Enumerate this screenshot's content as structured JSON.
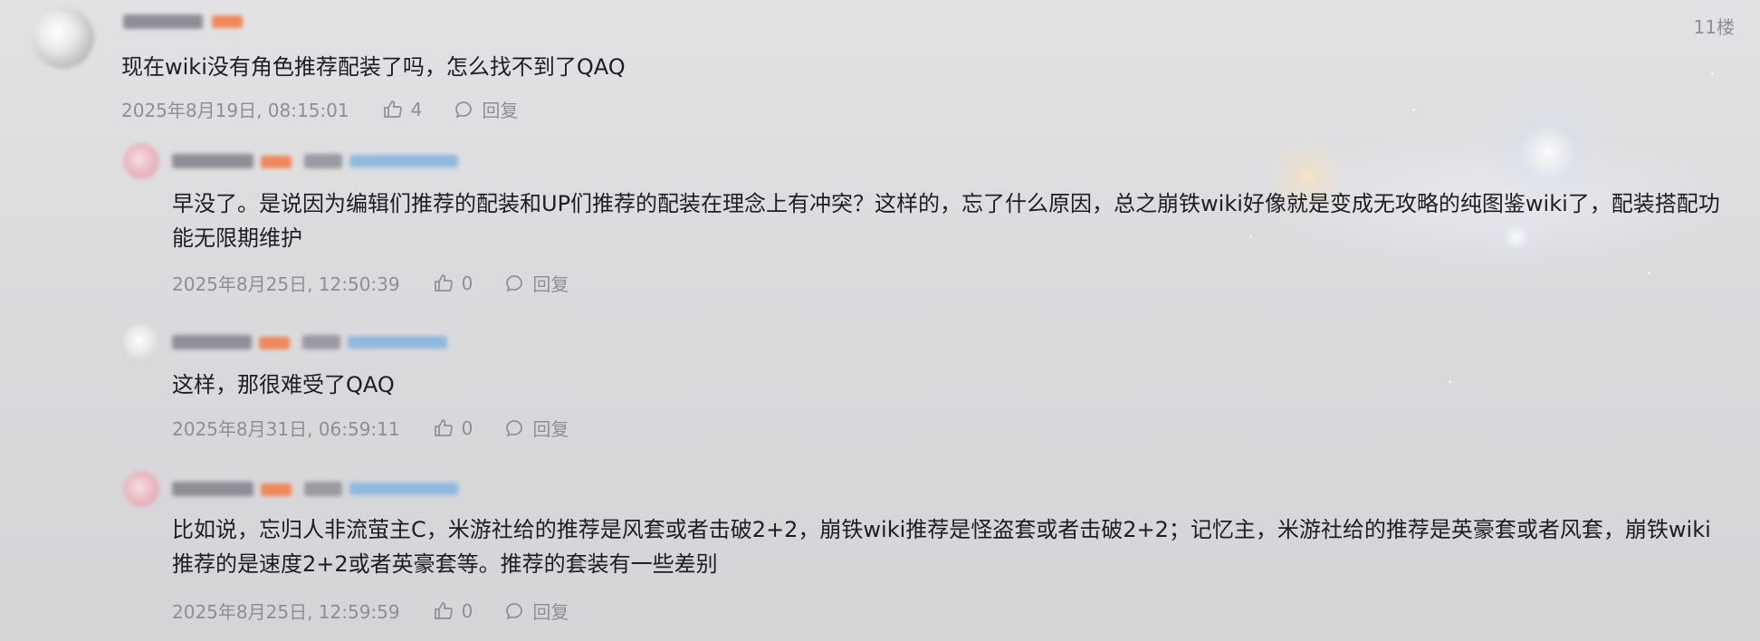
{
  "thread": {
    "floor_label": "11楼",
    "main": {
      "text": "现在wiki没有角色推荐配装了吗，怎么找不到了QAQ",
      "time": "2025年8月19日, 08:15:01",
      "likes": "4",
      "reply_label": "回复"
    },
    "replies": [
      {
        "text": "早没了。是说因为编辑们推荐的配装和UP们推荐的配装在理念上有冲突？这样的，忘了什么原因，总之崩铁wiki好像就是变成无攻略的纯图鉴wiki了，配装搭配功能无限期维护",
        "time": "2025年8月25日, 12:50:39",
        "likes": "0",
        "reply_label": "回复"
      },
      {
        "text": "这样，那很难受了QAQ",
        "time": "2025年8月31日, 06:59:11",
        "likes": "0",
        "reply_label": "回复"
      },
      {
        "text": "比如说，忘归人非流萤主C，米游社给的推荐是风套或者击破2+2，崩铁wiki推荐是怪盗套或者击破2+2；记忆主，米游社给的推荐是英豪套或者风套，崩铁wiki推荐的是速度2+2或者英豪套等。推荐的套装有一些差别",
        "time": "2025年8月25日, 12:59:59",
        "likes": "0",
        "reply_label": "回复"
      }
    ]
  },
  "colors": {
    "text": "#1e1e22",
    "meta": "#8e8e95",
    "badge": "#f0895a",
    "tag": "#8fb9dd"
  },
  "icons": {
    "like": "thumbs-up-icon",
    "reply": "comment-bubble-icon"
  }
}
